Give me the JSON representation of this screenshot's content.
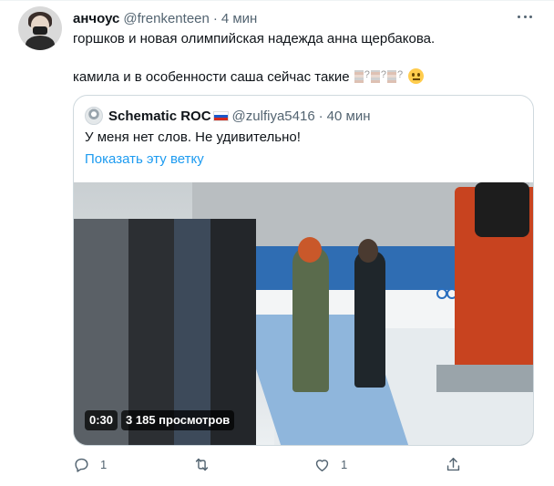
{
  "tweet": {
    "display_name": "анчоус",
    "handle": "@frenkenteen",
    "separator": "·",
    "time": "4 мин",
    "line1": "горшков и новая олимпийская надежда анна щербакова.",
    "line2": "камила и в особенности саша сейчас такие",
    "emoji_end": "neutral-face-emoji"
  },
  "quoted": {
    "display_name": "Schematic ROC",
    "flag": "russia-flag",
    "handle": "@zulfiya5416",
    "separator": "·",
    "time": "40 мин",
    "text": "У меня нет слов. Не удивительно!",
    "show_thread": "Показать эту ветку",
    "video": {
      "duration": "0:30",
      "views": "3 185 просмотров"
    }
  },
  "actions": {
    "reply_count": "1",
    "retweet_count": "",
    "like_count": "1",
    "icons": [
      "reply-icon",
      "retweet-icon",
      "like-icon",
      "share-icon"
    ]
  },
  "colors": {
    "text": "#0f1419",
    "secondary": "#536471",
    "link": "#1d9bf0",
    "border": "#cfd9de"
  }
}
